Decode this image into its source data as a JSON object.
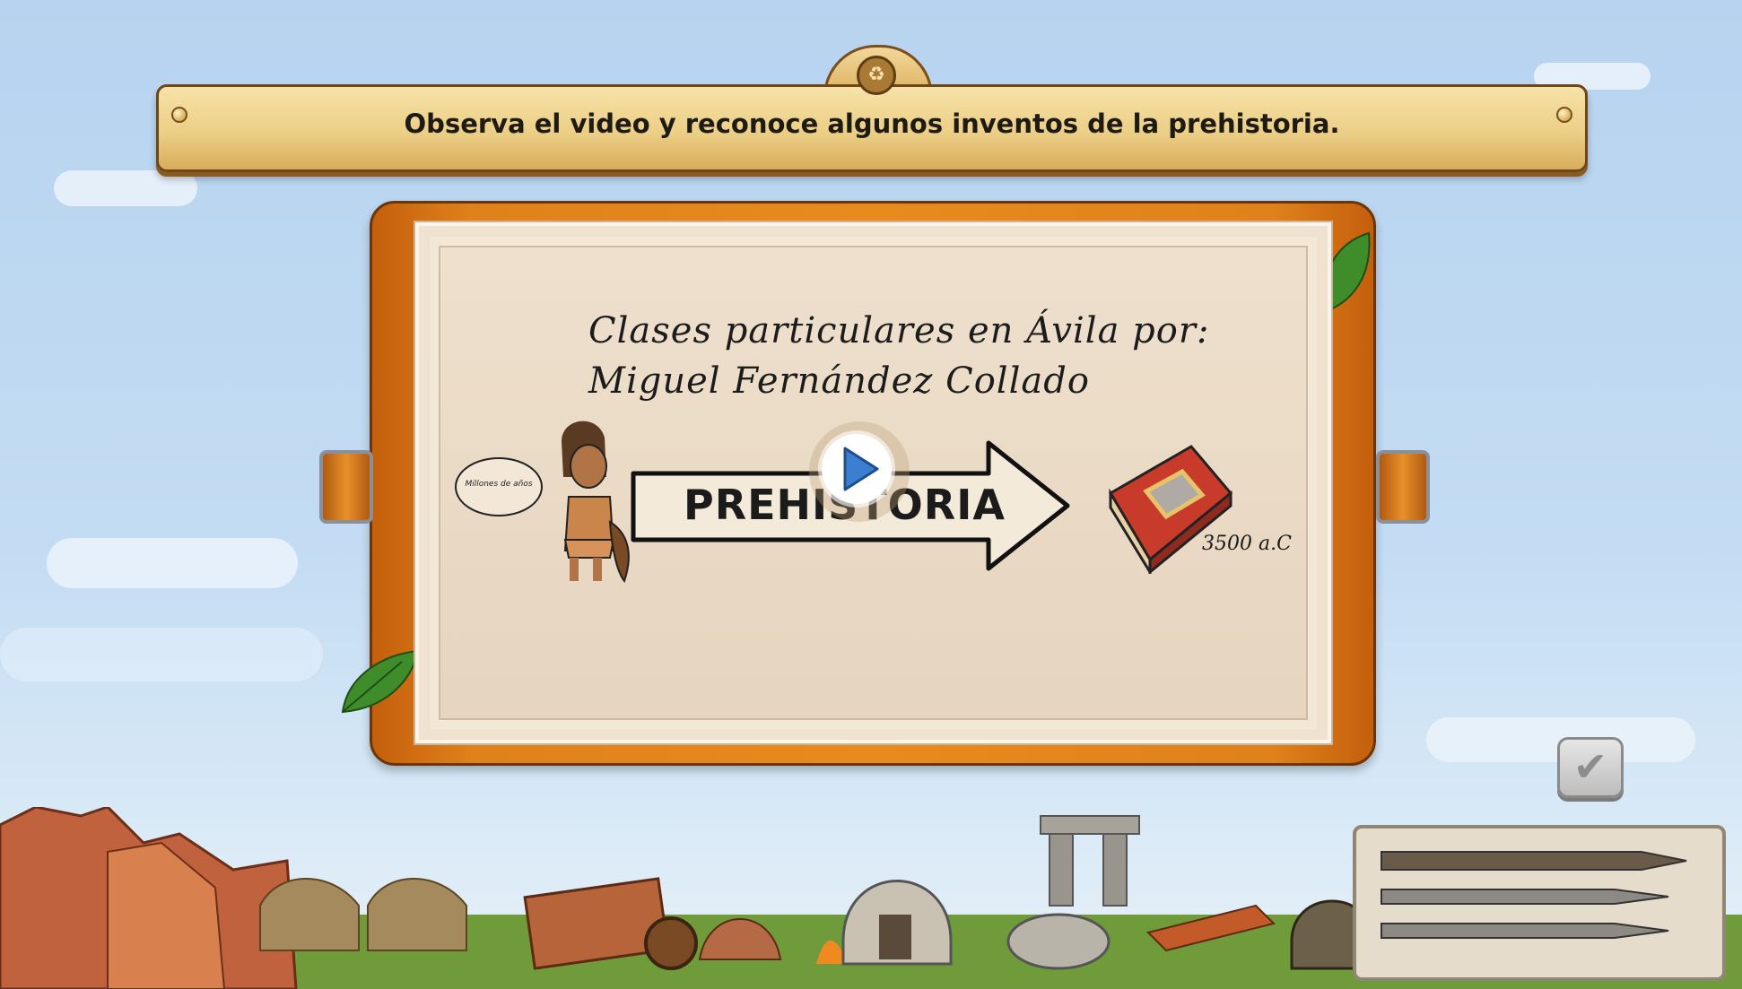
{
  "header": {
    "instruction": "Observa el video y reconoce algunos inventos de la prehistoria.",
    "top_icon": "recycle-icon"
  },
  "video": {
    "caption_line1": "Clases particulares en Ávila por:",
    "caption_line2": "Miguel Fernández Collado",
    "speech_bubble": "Millones de años",
    "timeline_label": "PREHISTORIA",
    "date_label": "3500 a.C",
    "play_icon": "play-icon"
  },
  "controls": {
    "check_icon": "check-icon"
  },
  "colors": {
    "banner": "#eccf87",
    "frame": "#e88a1d",
    "sky": "#b7d3ef",
    "play": "#3c7fd1"
  }
}
